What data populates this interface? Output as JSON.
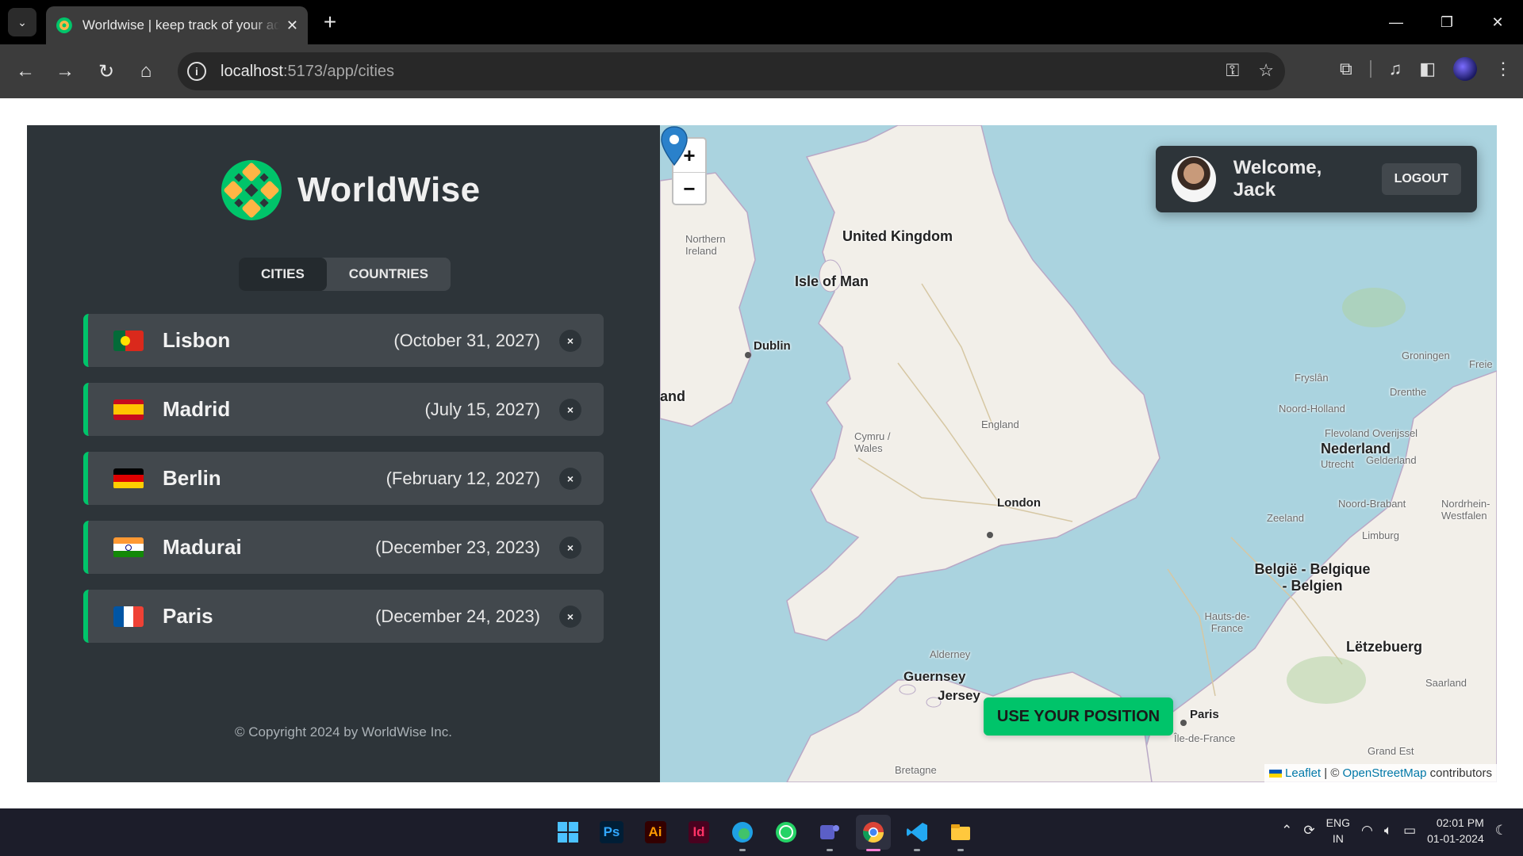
{
  "browser": {
    "tab_title": "Worldwise | keep track of your adventures",
    "url_host": "localhost",
    "url_path": ":5173/app/cities"
  },
  "app": {
    "brand": "WorldWise",
    "tabs": [
      "CITIES",
      "COUNTRIES"
    ],
    "active_tab": "CITIES",
    "cities": [
      {
        "name": "Lisbon",
        "date": "(October 31, 2027)",
        "flag": "portugal"
      },
      {
        "name": "Madrid",
        "date": "(July 15, 2027)",
        "flag": "spain"
      },
      {
        "name": "Berlin",
        "date": "(February 12, 2027)",
        "flag": "germany"
      },
      {
        "name": "Madurai",
        "date": "(December 23, 2023)",
        "flag": "india"
      },
      {
        "name": "Paris",
        "date": "(December 24, 2023)",
        "flag": "france"
      }
    ],
    "delete_glyph": "×",
    "copyright": "© Copyright 2024 by WorldWise Inc.",
    "accent_color": "#00c46a"
  },
  "map": {
    "zoom_in": "+",
    "zoom_out": "−",
    "welcome": "Welcome, Jack",
    "logout": "LOGOUT",
    "use_position": "USE YOUR POSITION",
    "attribution_leaflet": "Leaflet",
    "attribution_sep": " | © ",
    "attribution_osm": "OpenStreetMap",
    "attribution_tail": " contributors",
    "labels": {
      "united_kingdom": "United Kingdom",
      "isle_of_man": "Isle of Man",
      "northern_ireland": "Northern Ireland",
      "dublin": "Dublin",
      "land": "and",
      "cymru": "Cymru / Wales",
      "england": "England",
      "london": "London",
      "nederland": "Nederland",
      "belgie": "België - Belgique - Belgien",
      "letzebuerg": "Lëtzebuerg",
      "guernsey": "Guernsey",
      "jersey": "Jersey",
      "alderney": "Alderney",
      "paris": "Paris",
      "ile_de_france": "Île-de-France",
      "hauts_de_france": "Hauts-de-France",
      "bretagne": "Bretagne",
      "grand_est": "Grand Est",
      "groningen": "Groningen",
      "fryslan": "Fryslân",
      "drenthe": "Drenthe",
      "noord_holland": "Noord-Holland",
      "utrecht": "Utrecht",
      "flevoland": "Flevoland",
      "overijssel": "Overijssel",
      "gelderland": "Gelderland",
      "noord_brabant": "Noord-Brabant",
      "zeeland": "Zeeland",
      "limburg": "Limburg",
      "nordrhein": "Nordrhein-Westfalen",
      "saarland": "Saarland",
      "freie": "Freie"
    }
  },
  "taskbar": {
    "lang": "ENG",
    "region": "IN",
    "time": "02:01 PM",
    "date": "01-01-2024"
  }
}
